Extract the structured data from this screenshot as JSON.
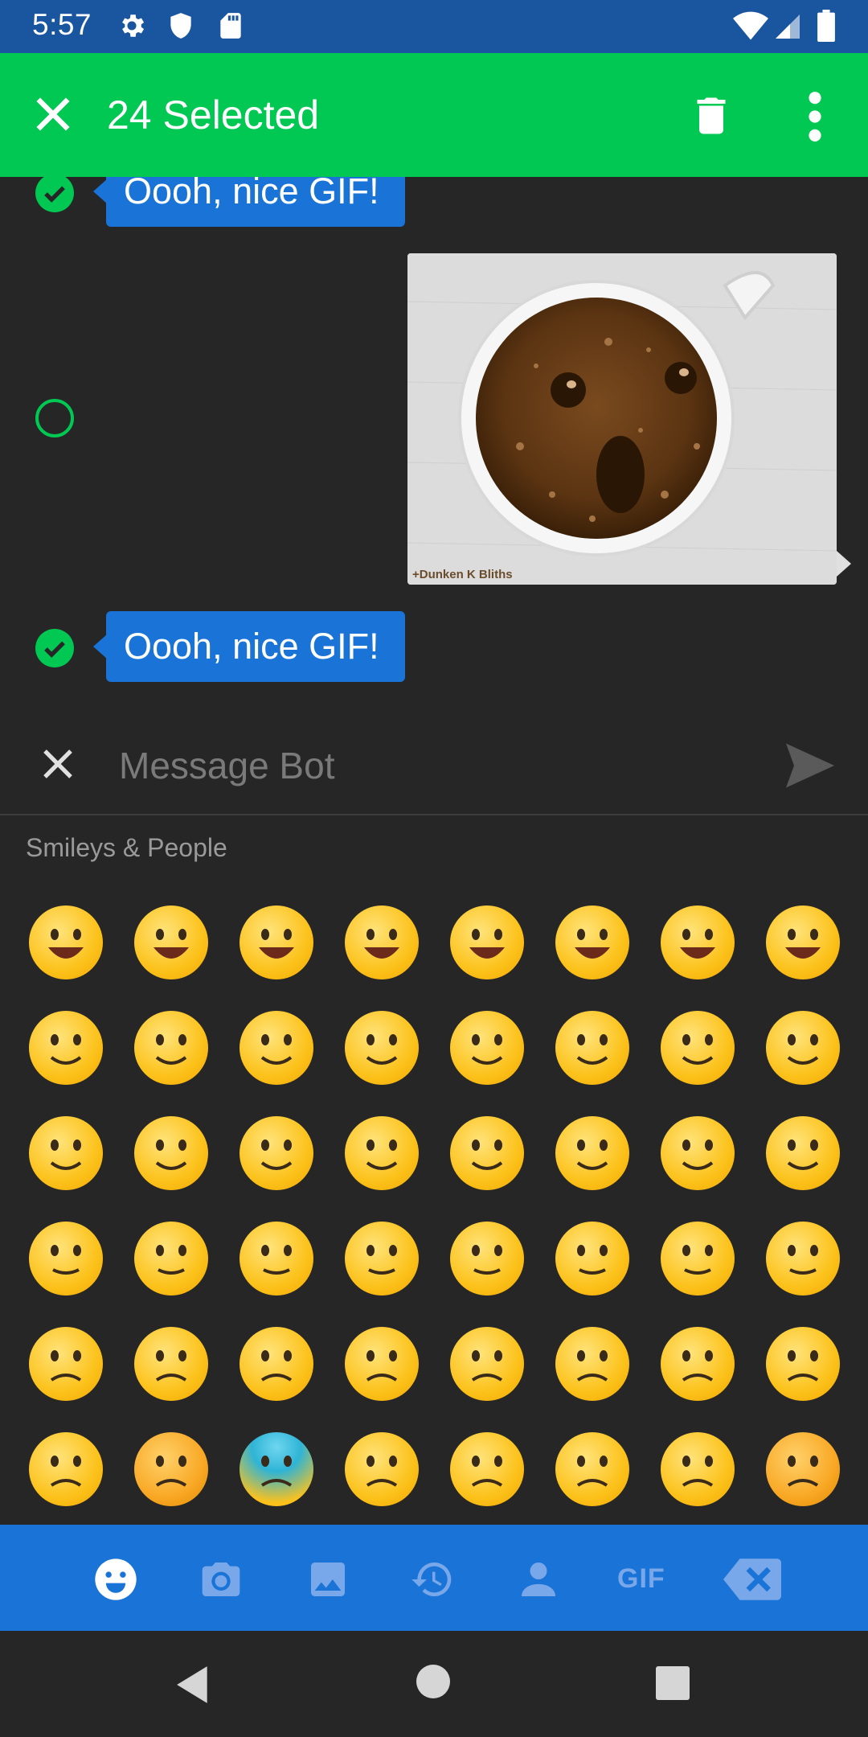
{
  "status_bar": {
    "time": "5:57",
    "icons": [
      "gear-icon",
      "shield-icon",
      "sd-card-icon",
      "wifi-icon",
      "signal-icon",
      "battery-icon"
    ]
  },
  "action_bar": {
    "title": "24 Selected",
    "color": "#00c853",
    "actions": [
      "close-icon",
      "delete-icon",
      "more-vert-icon"
    ]
  },
  "messages": [
    {
      "type": "text",
      "text": "Oooh, nice GIF!",
      "selected": true
    },
    {
      "type": "gif",
      "caption": "+Dunken K Bliths",
      "selected": false
    },
    {
      "type": "text",
      "text": "Oooh, nice GIF!",
      "selected": true
    }
  ],
  "compose": {
    "placeholder": "Message Bot",
    "value": ""
  },
  "emoji_panel": {
    "category_label": "Smileys & People",
    "emojis": [
      "😀",
      "😃",
      "😄",
      "😁",
      "😆",
      "😅",
      "😂",
      "🤣",
      "😊",
      "😊",
      "😇",
      "🙂",
      "🙃",
      "😉",
      "😌",
      "😍",
      "🥰",
      "😘",
      "😗",
      "😙",
      "😚",
      "😋",
      "😛",
      "😝",
      "😜",
      "🤪",
      "🤨",
      "🧐",
      "🤓",
      "😎",
      "🤩",
      "🥳",
      "😏",
      "😒",
      "😞",
      "😔",
      "😟",
      "😕",
      "🙁",
      "☹️",
      "😣",
      "😖",
      "😫",
      "😩",
      "🥺",
      "😢",
      "😭",
      "😤"
    ]
  },
  "tab_bar": {
    "color": "#1a73d6",
    "tabs": [
      "smileys-icon",
      "camera-icon",
      "image-icon",
      "recent-icon",
      "person-icon",
      "gif",
      "backspace-icon"
    ],
    "gif_label": "GIF"
  },
  "nav_bar": {
    "icons": [
      "back-icon",
      "home-icon",
      "recents-icon"
    ]
  }
}
